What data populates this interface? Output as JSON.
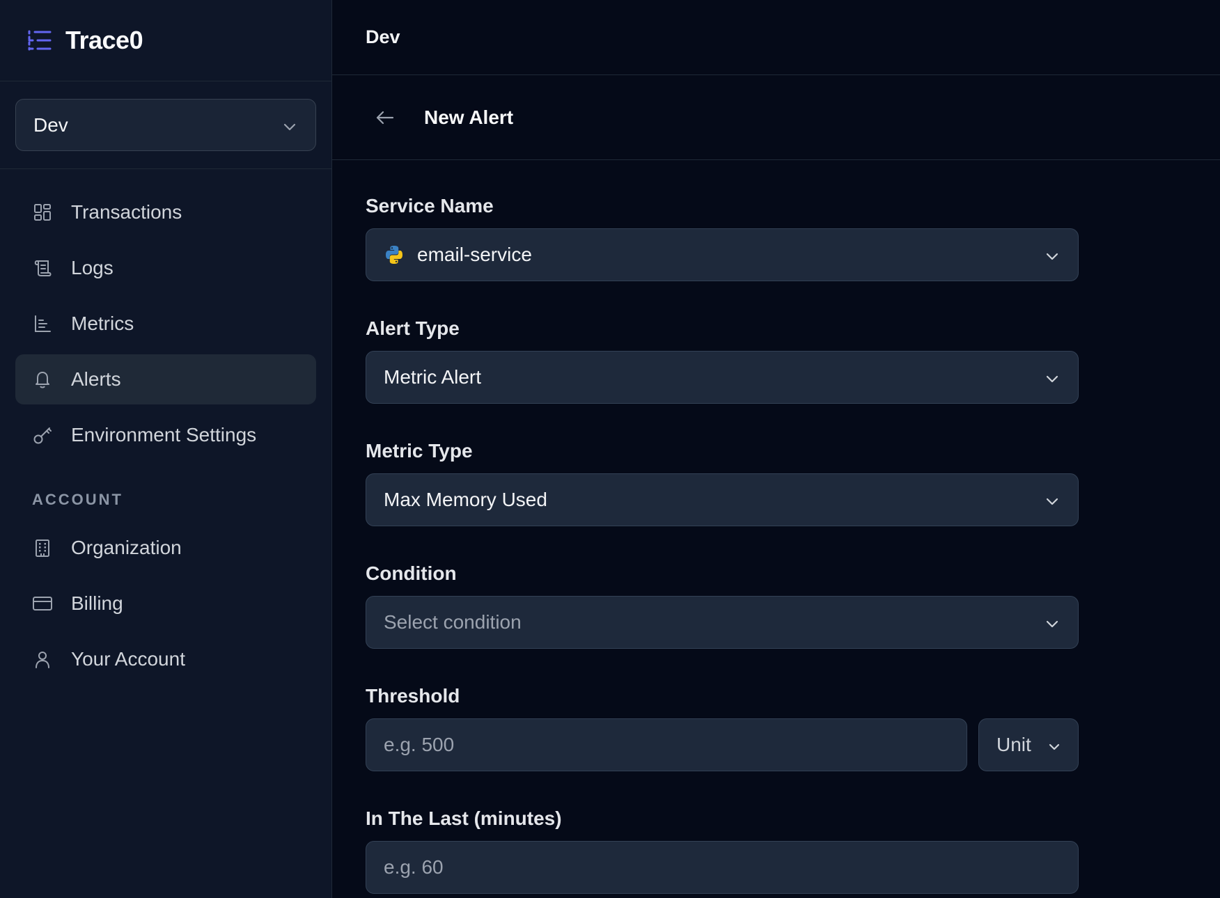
{
  "app": {
    "name": "Trace0"
  },
  "sidebar": {
    "env_selector": {
      "value": "Dev"
    },
    "nav": [
      {
        "label": "Transactions",
        "icon": "grid-icon"
      },
      {
        "label": "Logs",
        "icon": "scroll-icon"
      },
      {
        "label": "Metrics",
        "icon": "chart-icon"
      },
      {
        "label": "Alerts",
        "icon": "bell-icon",
        "active": true
      },
      {
        "label": "Environment Settings",
        "icon": "key-icon"
      }
    ],
    "account_section_label": "ACCOUNT",
    "account_nav": [
      {
        "label": "Organization",
        "icon": "building-icon"
      },
      {
        "label": "Billing",
        "icon": "credit-card-icon"
      },
      {
        "label": "Your Account",
        "icon": "user-icon"
      }
    ]
  },
  "header": {
    "breadcrumb": "Dev"
  },
  "page": {
    "title": "New Alert"
  },
  "form": {
    "service_name": {
      "label": "Service Name",
      "value": "email-service"
    },
    "alert_type": {
      "label": "Alert Type",
      "value": "Metric Alert"
    },
    "metric_type": {
      "label": "Metric Type",
      "value": "Max Memory Used"
    },
    "condition": {
      "label": "Condition",
      "placeholder": "Select condition"
    },
    "threshold": {
      "label": "Threshold",
      "placeholder": "e.g. 500",
      "unit": "Unit"
    },
    "in_the_last": {
      "label": "In The Last (minutes)",
      "placeholder": "e.g. 60"
    }
  },
  "colors": {
    "background": "#050a18",
    "sidebar": "#0e1628",
    "control": "#1e293b",
    "accent": "#6366f1"
  }
}
